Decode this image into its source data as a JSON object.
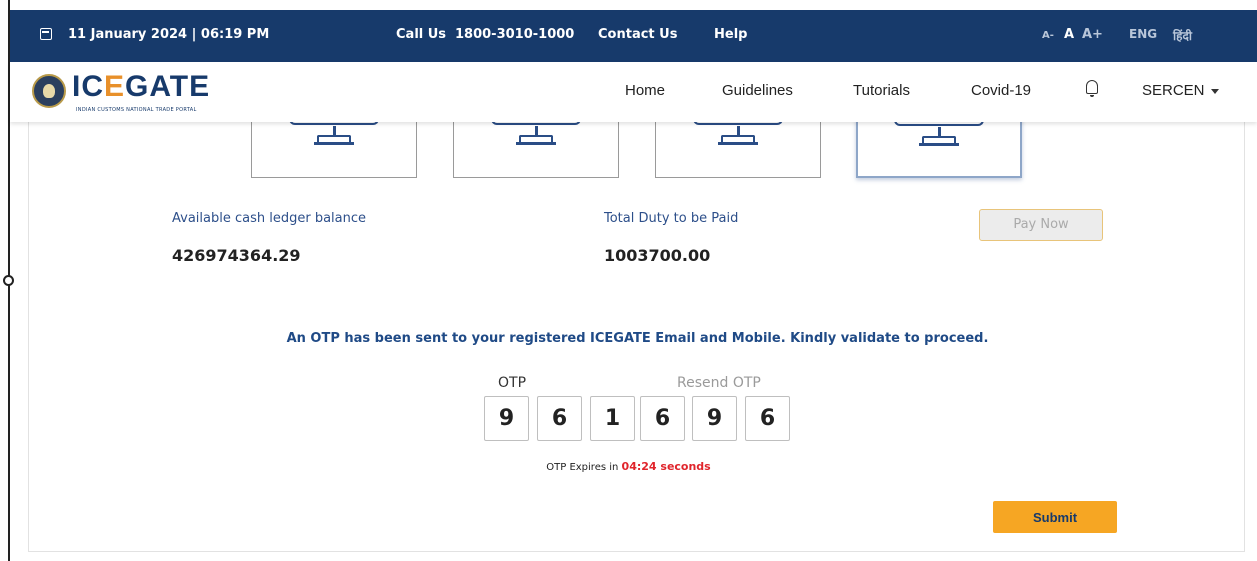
{
  "topbar": {
    "datetime": "11 January 2024 | 06:19 PM",
    "call_label": "Call Us",
    "phone": "1800-3010-1000",
    "contact": "Contact Us",
    "help": "Help",
    "font_small": "A-",
    "font_normal": "A",
    "font_large": "A+",
    "lang_en": "ENG",
    "lang_hi": "हिंदी",
    "calendar_icon": "calendar-icon",
    "background_color": "#173a6b"
  },
  "header": {
    "logo_text_a": "IC",
    "logo_text_b": "E",
    "logo_text_c": "GATE",
    "logo_tagline": "INDIAN CUSTOMS NATIONAL TRADE PORTAL",
    "nav": [
      "Home",
      "Guidelines",
      "Tutorials",
      "Covid-19"
    ],
    "bell_icon": "bell-icon",
    "user": "SERCEN"
  },
  "payment": {
    "cash_label": "Available cash ledger balance",
    "cash_value": "426974364.29",
    "duty_label": "Total Duty to be Paid",
    "duty_value": "1003700.00",
    "pay_now": "Pay Now"
  },
  "otp": {
    "message": "An OTP has been sent to your registered ICEGATE Email and Mobile. Kindly validate to proceed.",
    "label": "OTP",
    "resend": "Resend OTP",
    "digits": [
      "9",
      "6",
      "1",
      "6",
      "9",
      "6"
    ],
    "expiry_prefix": "OTP Expires in",
    "expiry_time": "04:24 seconds",
    "submit": "Submit"
  },
  "colors": {
    "accent_orange": "#f6a623",
    "brand_blue": "#173a6b",
    "expiry_red": "#e0242b"
  }
}
